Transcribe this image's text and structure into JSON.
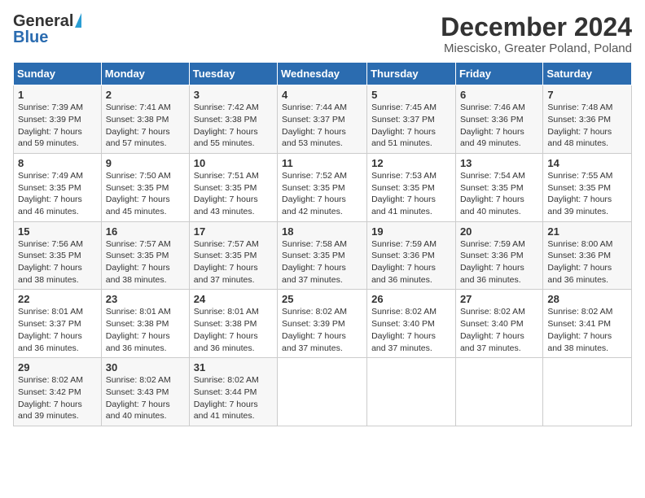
{
  "logo": {
    "general": "General",
    "blue": "Blue"
  },
  "title": "December 2024",
  "subtitle": "Miescisko, Greater Poland, Poland",
  "weekdays": [
    "Sunday",
    "Monday",
    "Tuesday",
    "Wednesday",
    "Thursday",
    "Friday",
    "Saturday"
  ],
  "weeks": [
    [
      {
        "day": "1",
        "sunrise": "Sunrise: 7:39 AM",
        "sunset": "Sunset: 3:39 PM",
        "daylight": "Daylight: 7 hours and 59 minutes."
      },
      {
        "day": "2",
        "sunrise": "Sunrise: 7:41 AM",
        "sunset": "Sunset: 3:38 PM",
        "daylight": "Daylight: 7 hours and 57 minutes."
      },
      {
        "day": "3",
        "sunrise": "Sunrise: 7:42 AM",
        "sunset": "Sunset: 3:38 PM",
        "daylight": "Daylight: 7 hours and 55 minutes."
      },
      {
        "day": "4",
        "sunrise": "Sunrise: 7:44 AM",
        "sunset": "Sunset: 3:37 PM",
        "daylight": "Daylight: 7 hours and 53 minutes."
      },
      {
        "day": "5",
        "sunrise": "Sunrise: 7:45 AM",
        "sunset": "Sunset: 3:37 PM",
        "daylight": "Daylight: 7 hours and 51 minutes."
      },
      {
        "day": "6",
        "sunrise": "Sunrise: 7:46 AM",
        "sunset": "Sunset: 3:36 PM",
        "daylight": "Daylight: 7 hours and 49 minutes."
      },
      {
        "day": "7",
        "sunrise": "Sunrise: 7:48 AM",
        "sunset": "Sunset: 3:36 PM",
        "daylight": "Daylight: 7 hours and 48 minutes."
      }
    ],
    [
      {
        "day": "8",
        "sunrise": "Sunrise: 7:49 AM",
        "sunset": "Sunset: 3:35 PM",
        "daylight": "Daylight: 7 hours and 46 minutes."
      },
      {
        "day": "9",
        "sunrise": "Sunrise: 7:50 AM",
        "sunset": "Sunset: 3:35 PM",
        "daylight": "Daylight: 7 hours and 45 minutes."
      },
      {
        "day": "10",
        "sunrise": "Sunrise: 7:51 AM",
        "sunset": "Sunset: 3:35 PM",
        "daylight": "Daylight: 7 hours and 43 minutes."
      },
      {
        "day": "11",
        "sunrise": "Sunrise: 7:52 AM",
        "sunset": "Sunset: 3:35 PM",
        "daylight": "Daylight: 7 hours and 42 minutes."
      },
      {
        "day": "12",
        "sunrise": "Sunrise: 7:53 AM",
        "sunset": "Sunset: 3:35 PM",
        "daylight": "Daylight: 7 hours and 41 minutes."
      },
      {
        "day": "13",
        "sunrise": "Sunrise: 7:54 AM",
        "sunset": "Sunset: 3:35 PM",
        "daylight": "Daylight: 7 hours and 40 minutes."
      },
      {
        "day": "14",
        "sunrise": "Sunrise: 7:55 AM",
        "sunset": "Sunset: 3:35 PM",
        "daylight": "Daylight: 7 hours and 39 minutes."
      }
    ],
    [
      {
        "day": "15",
        "sunrise": "Sunrise: 7:56 AM",
        "sunset": "Sunset: 3:35 PM",
        "daylight": "Daylight: 7 hours and 38 minutes."
      },
      {
        "day": "16",
        "sunrise": "Sunrise: 7:57 AM",
        "sunset": "Sunset: 3:35 PM",
        "daylight": "Daylight: 7 hours and 38 minutes."
      },
      {
        "day": "17",
        "sunrise": "Sunrise: 7:57 AM",
        "sunset": "Sunset: 3:35 PM",
        "daylight": "Daylight: 7 hours and 37 minutes."
      },
      {
        "day": "18",
        "sunrise": "Sunrise: 7:58 AM",
        "sunset": "Sunset: 3:35 PM",
        "daylight": "Daylight: 7 hours and 37 minutes."
      },
      {
        "day": "19",
        "sunrise": "Sunrise: 7:59 AM",
        "sunset": "Sunset: 3:36 PM",
        "daylight": "Daylight: 7 hours and 36 minutes."
      },
      {
        "day": "20",
        "sunrise": "Sunrise: 7:59 AM",
        "sunset": "Sunset: 3:36 PM",
        "daylight": "Daylight: 7 hours and 36 minutes."
      },
      {
        "day": "21",
        "sunrise": "Sunrise: 8:00 AM",
        "sunset": "Sunset: 3:36 PM",
        "daylight": "Daylight: 7 hours and 36 minutes."
      }
    ],
    [
      {
        "day": "22",
        "sunrise": "Sunrise: 8:01 AM",
        "sunset": "Sunset: 3:37 PM",
        "daylight": "Daylight: 7 hours and 36 minutes."
      },
      {
        "day": "23",
        "sunrise": "Sunrise: 8:01 AM",
        "sunset": "Sunset: 3:38 PM",
        "daylight": "Daylight: 7 hours and 36 minutes."
      },
      {
        "day": "24",
        "sunrise": "Sunrise: 8:01 AM",
        "sunset": "Sunset: 3:38 PM",
        "daylight": "Daylight: 7 hours and 36 minutes."
      },
      {
        "day": "25",
        "sunrise": "Sunrise: 8:02 AM",
        "sunset": "Sunset: 3:39 PM",
        "daylight": "Daylight: 7 hours and 37 minutes."
      },
      {
        "day": "26",
        "sunrise": "Sunrise: 8:02 AM",
        "sunset": "Sunset: 3:40 PM",
        "daylight": "Daylight: 7 hours and 37 minutes."
      },
      {
        "day": "27",
        "sunrise": "Sunrise: 8:02 AM",
        "sunset": "Sunset: 3:40 PM",
        "daylight": "Daylight: 7 hours and 37 minutes."
      },
      {
        "day": "28",
        "sunrise": "Sunrise: 8:02 AM",
        "sunset": "Sunset: 3:41 PM",
        "daylight": "Daylight: 7 hours and 38 minutes."
      }
    ],
    [
      {
        "day": "29",
        "sunrise": "Sunrise: 8:02 AM",
        "sunset": "Sunset: 3:42 PM",
        "daylight": "Daylight: 7 hours and 39 minutes."
      },
      {
        "day": "30",
        "sunrise": "Sunrise: 8:02 AM",
        "sunset": "Sunset: 3:43 PM",
        "daylight": "Daylight: 7 hours and 40 minutes."
      },
      {
        "day": "31",
        "sunrise": "Sunrise: 8:02 AM",
        "sunset": "Sunset: 3:44 PM",
        "daylight": "Daylight: 7 hours and 41 minutes."
      },
      null,
      null,
      null,
      null
    ]
  ]
}
